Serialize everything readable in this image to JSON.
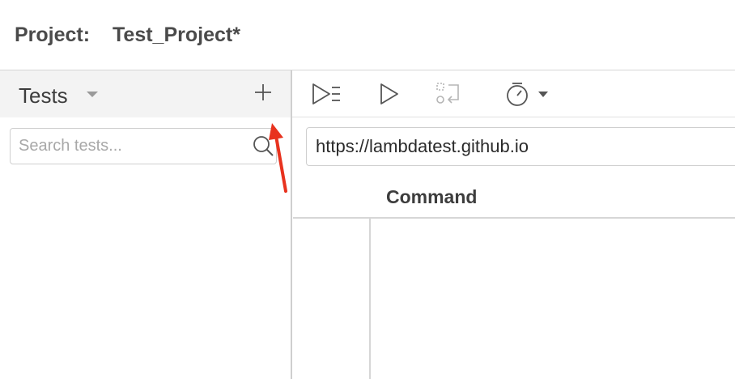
{
  "header": {
    "project_label": "Project:",
    "project_name": "Test_Project*"
  },
  "sidebar": {
    "title": "Tests",
    "search_placeholder": "Search tests...",
    "icons": {
      "dropdown": "chevron-down-icon",
      "add": "plus-icon",
      "search": "search-icon"
    }
  },
  "toolbar": {
    "icons": [
      "run-all-tests-icon",
      "run-current-test-icon",
      "step-over-icon",
      "speed-timer-icon",
      "chevron-down-icon"
    ]
  },
  "main": {
    "url_value": "https://lambdatest.github.io",
    "command_header": "Command"
  },
  "annotation": {
    "color": "#e8321e",
    "icon": "red-arrow-annotation"
  }
}
